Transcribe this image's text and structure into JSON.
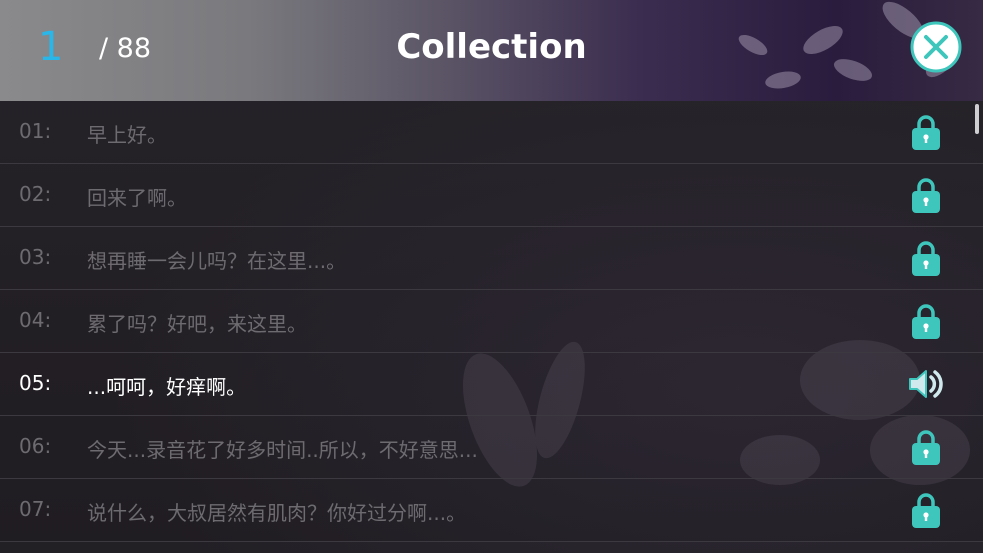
{
  "header": {
    "current_index": "1",
    "total": "/ 88",
    "title": "Collection"
  },
  "colors": {
    "accent": "#29b6e8",
    "lock_teal": "#3ec6bc",
    "inactive_text": "#6d6a70",
    "active_text": "#ffffff"
  },
  "rows": [
    {
      "num": "01:",
      "text": "早上好。",
      "icon": "lock-icon",
      "active": false
    },
    {
      "num": "02:",
      "text": "回来了啊。",
      "icon": "lock-icon",
      "active": false
    },
    {
      "num": "03:",
      "text": "想再睡一会儿吗？在这里...。",
      "icon": "lock-icon",
      "active": false
    },
    {
      "num": "04:",
      "text": "累了吗？好吧，来这里。",
      "icon": "lock-icon",
      "active": false
    },
    {
      "num": "05:",
      "text": "...呵呵，好痒啊。",
      "icon": "speaker-icon",
      "active": true
    },
    {
      "num": "06:",
      "text": "今天...录音花了好多时间..所以，不好意思...",
      "icon": "lock-icon",
      "active": false
    },
    {
      "num": "07:",
      "text": "说什么，大叔居然有肌肉？你好过分啊...。",
      "icon": "lock-icon",
      "active": false
    }
  ]
}
